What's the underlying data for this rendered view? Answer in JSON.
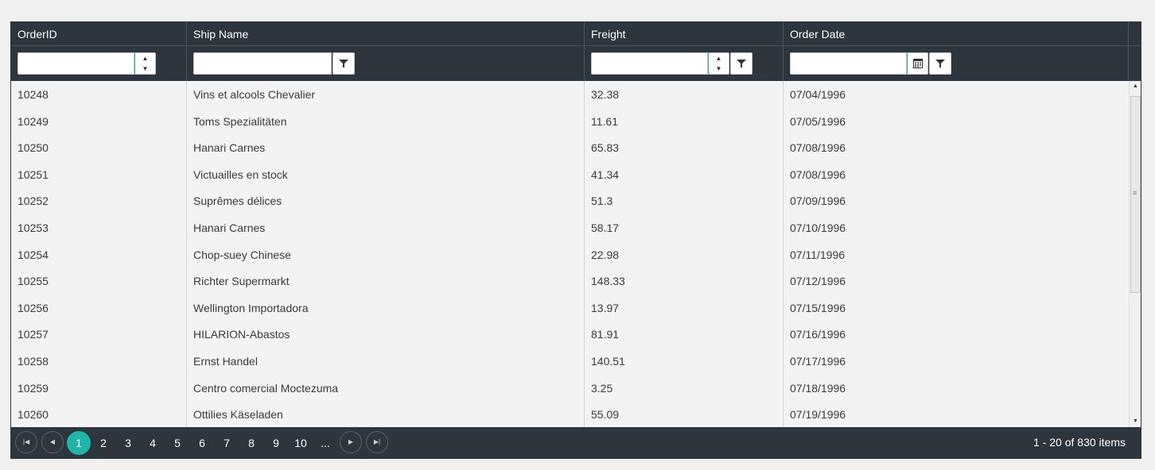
{
  "columns": {
    "order_id": "OrderID",
    "ship_name": "Ship Name",
    "freight": "Freight",
    "order_date": "Order Date"
  },
  "filters": {
    "order_id_value": "",
    "ship_name_value": "",
    "freight_value": "",
    "order_date_value": ""
  },
  "rows": [
    {
      "order_id": "10248",
      "ship_name": "Vins et alcools Chevalier",
      "freight": "32.38",
      "order_date": "07/04/1996"
    },
    {
      "order_id": "10249",
      "ship_name": "Toms Spezialitäten",
      "freight": "11.61",
      "order_date": "07/05/1996"
    },
    {
      "order_id": "10250",
      "ship_name": "Hanari Carnes",
      "freight": "65.83",
      "order_date": "07/08/1996"
    },
    {
      "order_id": "10251",
      "ship_name": "Victuailles en stock",
      "freight": "41.34",
      "order_date": "07/08/1996"
    },
    {
      "order_id": "10252",
      "ship_name": "Suprêmes délices",
      "freight": "51.3",
      "order_date": "07/09/1996"
    },
    {
      "order_id": "10253",
      "ship_name": "Hanari Carnes",
      "freight": "58.17",
      "order_date": "07/10/1996"
    },
    {
      "order_id": "10254",
      "ship_name": "Chop-suey Chinese",
      "freight": "22.98",
      "order_date": "07/11/1996"
    },
    {
      "order_id": "10255",
      "ship_name": "Richter Supermarkt",
      "freight": "148.33",
      "order_date": "07/12/1996"
    },
    {
      "order_id": "10256",
      "ship_name": "Wellington Importadora",
      "freight": "13.97",
      "order_date": "07/15/1996"
    },
    {
      "order_id": "10257",
      "ship_name": "HILARION-Abastos",
      "freight": "81.91",
      "order_date": "07/16/1996"
    },
    {
      "order_id": "10258",
      "ship_name": "Ernst Handel",
      "freight": "140.51",
      "order_date": "07/17/1996"
    },
    {
      "order_id": "10259",
      "ship_name": "Centro comercial Moctezuma",
      "freight": "3.25",
      "order_date": "07/18/1996"
    },
    {
      "order_id": "10260",
      "ship_name": "Ottilies Käseladen",
      "freight": "55.09",
      "order_date": "07/19/1996"
    }
  ],
  "pager": {
    "pages": [
      "1",
      "2",
      "3",
      "4",
      "5",
      "6",
      "7",
      "8",
      "9",
      "10",
      "..."
    ],
    "current_page": "1",
    "info": "1 - 20 of 830 items"
  },
  "icons": {
    "filter": "filter-icon",
    "calendar": "calendar-icon",
    "spin_up": "arrow-up-icon",
    "spin_down": "arrow-down-icon",
    "first": "first-page-icon",
    "prev": "previous-page-icon",
    "next": "next-page-icon",
    "last": "last-page-icon"
  },
  "colors": {
    "header_bg": "#2d353d",
    "accent": "#1fb5a8",
    "grid_bg": "#f3f3f3"
  }
}
